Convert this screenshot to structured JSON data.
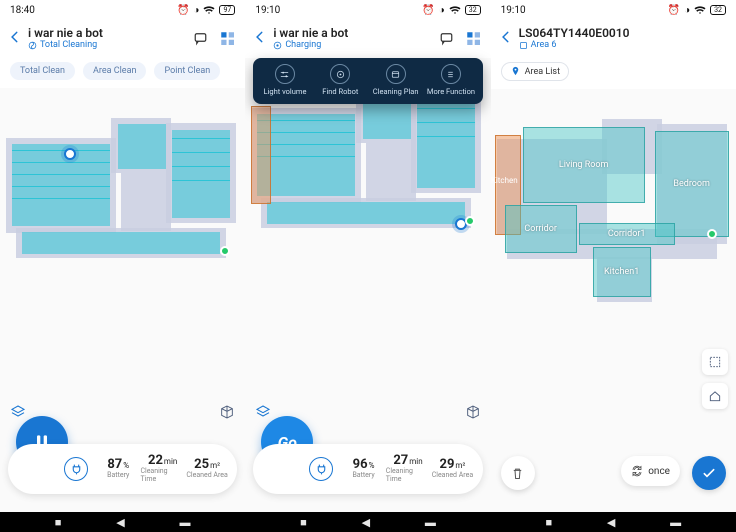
{
  "left": {
    "status": {
      "time": "18:40",
      "battery_label": "97"
    },
    "title": "i war nie a bot",
    "subtitle": "Total Cleaning",
    "chips": [
      "Total Clean",
      "Area Clean",
      "Point Clean"
    ],
    "big_button": "pause",
    "stats": {
      "battery": {
        "value": "87",
        "unit": "%",
        "label": "Battery"
      },
      "time": {
        "value": "22",
        "unit": "min",
        "label": "Cleaning Time"
      },
      "area": {
        "value": "25",
        "unit": "m²",
        "label": "Cleaned Area"
      }
    }
  },
  "mid": {
    "status": {
      "time": "19:10",
      "battery_label": "32"
    },
    "title": "i war nie a bot",
    "subtitle": "Charging",
    "dropdown": [
      "Light volume",
      "Find Robot",
      "Cleaning Plan",
      "More Function"
    ],
    "big_button_text": "Go",
    "stats": {
      "battery": {
        "value": "96",
        "unit": "%",
        "label": "Battery"
      },
      "time": {
        "value": "27",
        "unit": "min",
        "label": "Cleaning Time"
      },
      "area": {
        "value": "29",
        "unit": "m²",
        "label": "Cleaned Area"
      }
    }
  },
  "right": {
    "status": {
      "time": "19:10",
      "battery_label": "32"
    },
    "title": "LS064TY1440E0010",
    "subtitle": "Area 6",
    "area_list_label": "Area List",
    "zones": {
      "kitchen": "Kitchen",
      "living": "Living Room",
      "bedroom": "Bedroom",
      "corridor": "Corridor",
      "corridor1": "Corridor1",
      "kitchen1": "Kitchen1"
    },
    "once_label": "once"
  }
}
